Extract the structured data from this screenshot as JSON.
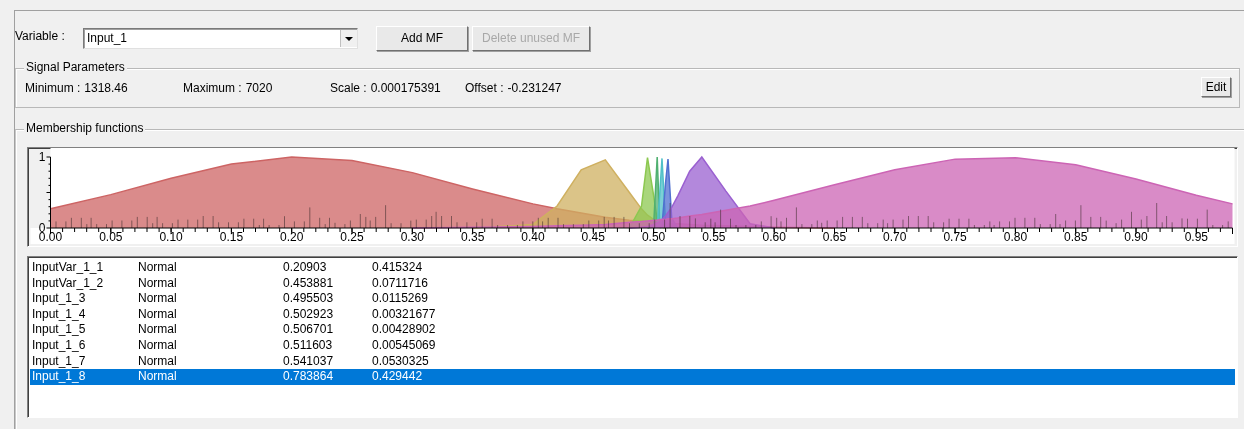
{
  "variable": {
    "label": "Variable :",
    "value": "Input_1"
  },
  "buttons": [
    {
      "label": "Add MF",
      "disabled": false
    },
    {
      "label": "Delete unused MF",
      "disabled": true
    }
  ],
  "signal_parameters": {
    "title": "Signal Parameters",
    "fields": [
      {
        "label": "Minimum :",
        "value": "1318.46"
      },
      {
        "label": "Maximum :",
        "value": "7020"
      },
      {
        "label": "Scale :",
        "value": "0.000175391"
      },
      {
        "label": "Offset :",
        "value": "-0.231247"
      }
    ],
    "edit_button": "Edit"
  },
  "membership_functions": {
    "title": "Membership functions",
    "chart_data": {
      "type": "area",
      "xlim": [
        0,
        0.98
      ],
      "ylim": [
        0,
        1
      ],
      "yticks": [
        0,
        1
      ],
      "xticks": [
        {
          "value": 0,
          "label": "0.00"
        },
        {
          "value": 0.05,
          "label": "0.05"
        },
        {
          "value": 0.1,
          "label": "0.10"
        },
        {
          "value": 0.15,
          "label": "0.15"
        },
        {
          "value": 0.2,
          "label": "0.20"
        },
        {
          "value": 0.25,
          "label": "0.25"
        },
        {
          "value": 0.3,
          "label": "0.30"
        },
        {
          "value": 0.35,
          "label": "0.35"
        },
        {
          "value": 0.4,
          "label": "0.40"
        },
        {
          "value": 0.45,
          "label": "0.45"
        },
        {
          "value": 0.5,
          "label": "0.50"
        },
        {
          "value": 0.55,
          "label": "0.55"
        },
        {
          "value": 0.6,
          "label": "0.60"
        },
        {
          "value": 0.65,
          "label": "0.65"
        },
        {
          "value": 0.7,
          "label": "0.70"
        },
        {
          "value": 0.75,
          "label": "0.75"
        },
        {
          "value": 0.8,
          "label": "0.80"
        },
        {
          "value": 0.85,
          "label": "0.85"
        },
        {
          "value": 0.9,
          "label": "0.90"
        },
        {
          "value": 0.95,
          "label": "0.95"
        }
      ],
      "x": [
        0,
        0.05,
        0.1,
        0.15,
        0.2,
        0.25,
        0.3,
        0.35,
        0.4,
        0.42,
        0.44,
        0.46,
        0.48,
        0.49,
        0.495,
        0.5,
        0.503,
        0.505,
        0.507,
        0.51,
        0.512,
        0.515,
        0.52,
        0.53,
        0.54,
        0.56,
        0.58,
        0.6,
        0.65,
        0.7,
        0.75,
        0.8,
        0.85,
        0.9,
        0.95,
        0.98
      ],
      "series": [
        {
          "color": "#cd6464",
          "values": [
            0.27,
            0.47,
            0.7,
            0.9,
            1,
            0.95,
            0.78,
            0.55,
            0.34,
            0.27,
            0.21,
            0.15,
            0.11,
            0.1,
            0.09,
            0.08,
            0.08,
            0.07,
            0.07,
            0.07,
            0.06,
            0.06,
            0.06,
            0.05,
            0.04,
            0.03,
            0.02,
            0.01,
            0,
            null,
            null,
            null,
            null,
            null,
            null,
            null
          ]
        },
        {
          "color": "#cfb060",
          "values": [
            null,
            null,
            null,
            null,
            null,
            null,
            null,
            0,
            0.05,
            0.31,
            0.82,
            0.96,
            0.5,
            0.27,
            0.18,
            0.12,
            0.09,
            0.07,
            0.06,
            0.04,
            0.03,
            0.02,
            0.01,
            0,
            null,
            null,
            null,
            null,
            null,
            null,
            null,
            null,
            null,
            null,
            null,
            null
          ]
        },
        {
          "color": "#8cc850",
          "values": [
            null,
            null,
            null,
            null,
            null,
            null,
            null,
            null,
            null,
            null,
            null,
            null,
            0,
            0.31,
            0.99,
            0.46,
            0.11,
            0.03,
            0.01,
            0,
            null,
            null,
            null,
            null,
            null,
            null,
            null,
            null,
            null,
            null,
            null,
            null,
            null,
            null,
            null,
            null
          ]
        },
        {
          "color": "#50b070",
          "values": [
            null,
            null,
            null,
            null,
            null,
            null,
            null,
            null,
            null,
            null,
            null,
            null,
            null,
            null,
            0,
            0.02,
            1,
            0.11,
            0,
            null,
            null,
            null,
            null,
            null,
            null,
            null,
            null,
            null,
            null,
            null,
            null,
            null,
            null,
            null,
            null,
            null
          ]
        },
        {
          "color": "#50c0c8",
          "values": [
            null,
            null,
            null,
            null,
            null,
            null,
            null,
            null,
            null,
            null,
            null,
            null,
            null,
            null,
            null,
            0,
            0.02,
            0.45,
            0.98,
            0.05,
            0,
            null,
            null,
            null,
            null,
            null,
            null,
            null,
            null,
            null,
            null,
            null,
            null,
            null,
            null,
            null
          ]
        },
        {
          "color": "#5070d0",
          "values": [
            null,
            null,
            null,
            null,
            null,
            null,
            null,
            null,
            null,
            null,
            null,
            null,
            null,
            null,
            null,
            null,
            null,
            0,
            0.03,
            0.64,
            0.97,
            0.14,
            0,
            null,
            null,
            null,
            null,
            null,
            null,
            null,
            null,
            null,
            null,
            null,
            null,
            null
          ]
        },
        {
          "color": "#9a60d0",
          "values": [
            null,
            null,
            null,
            null,
            null,
            null,
            null,
            null,
            null,
            null,
            null,
            null,
            0,
            0.01,
            0.02,
            0.05,
            0.07,
            0.09,
            0.12,
            0.17,
            0.22,
            0.29,
            0.45,
            0.8,
            1,
            0.52,
            0.06,
            0,
            null,
            null,
            null,
            null,
            null,
            null,
            null,
            null
          ]
        },
        {
          "color": "#cc64b4",
          "values": [
            null,
            null,
            null,
            null,
            null,
            null,
            0,
            0.01,
            0.02,
            0.03,
            0.04,
            0.05,
            0.08,
            0.09,
            0.1,
            0.11,
            0.11,
            0.12,
            0.12,
            0.12,
            0.13,
            0.13,
            0.14,
            0.17,
            0.19,
            0.25,
            0.31,
            0.39,
            0.61,
            0.82,
            0.97,
            0.99,
            0.89,
            0.69,
            0.46,
            0.34
          ]
        }
      ]
    },
    "rows": [
      {
        "name": "InputVar_1_1",
        "type": "Normal",
        "column_3": "0.20903",
        "column_4": "0.415324",
        "selected": false
      },
      {
        "name": "InputVar_1_2",
        "type": "Normal",
        "column_3": "0.453881",
        "column_4": "0.0711716",
        "selected": false
      },
      {
        "name": "Input_1_3",
        "type": "Normal",
        "column_3": "0.495503",
        "column_4": "0.0115269",
        "selected": false
      },
      {
        "name": "Input_1_4",
        "type": "Normal",
        "column_3": "0.502923",
        "column_4": "0.00321677",
        "selected": false
      },
      {
        "name": "Input_1_5",
        "type": "Normal",
        "column_3": "0.506701",
        "column_4": "0.00428902",
        "selected": false
      },
      {
        "name": "Input_1_6",
        "type": "Normal",
        "column_3": "0.511603",
        "column_4": "0.00545069",
        "selected": false
      },
      {
        "name": "Input_1_7",
        "type": "Normal",
        "column_3": "0.541037",
        "column_4": "0.0530325",
        "selected": false
      },
      {
        "name": "Input_1_8",
        "type": "Normal",
        "column_3": "0.783864",
        "column_4": "0.429442",
        "selected": true
      }
    ]
  }
}
